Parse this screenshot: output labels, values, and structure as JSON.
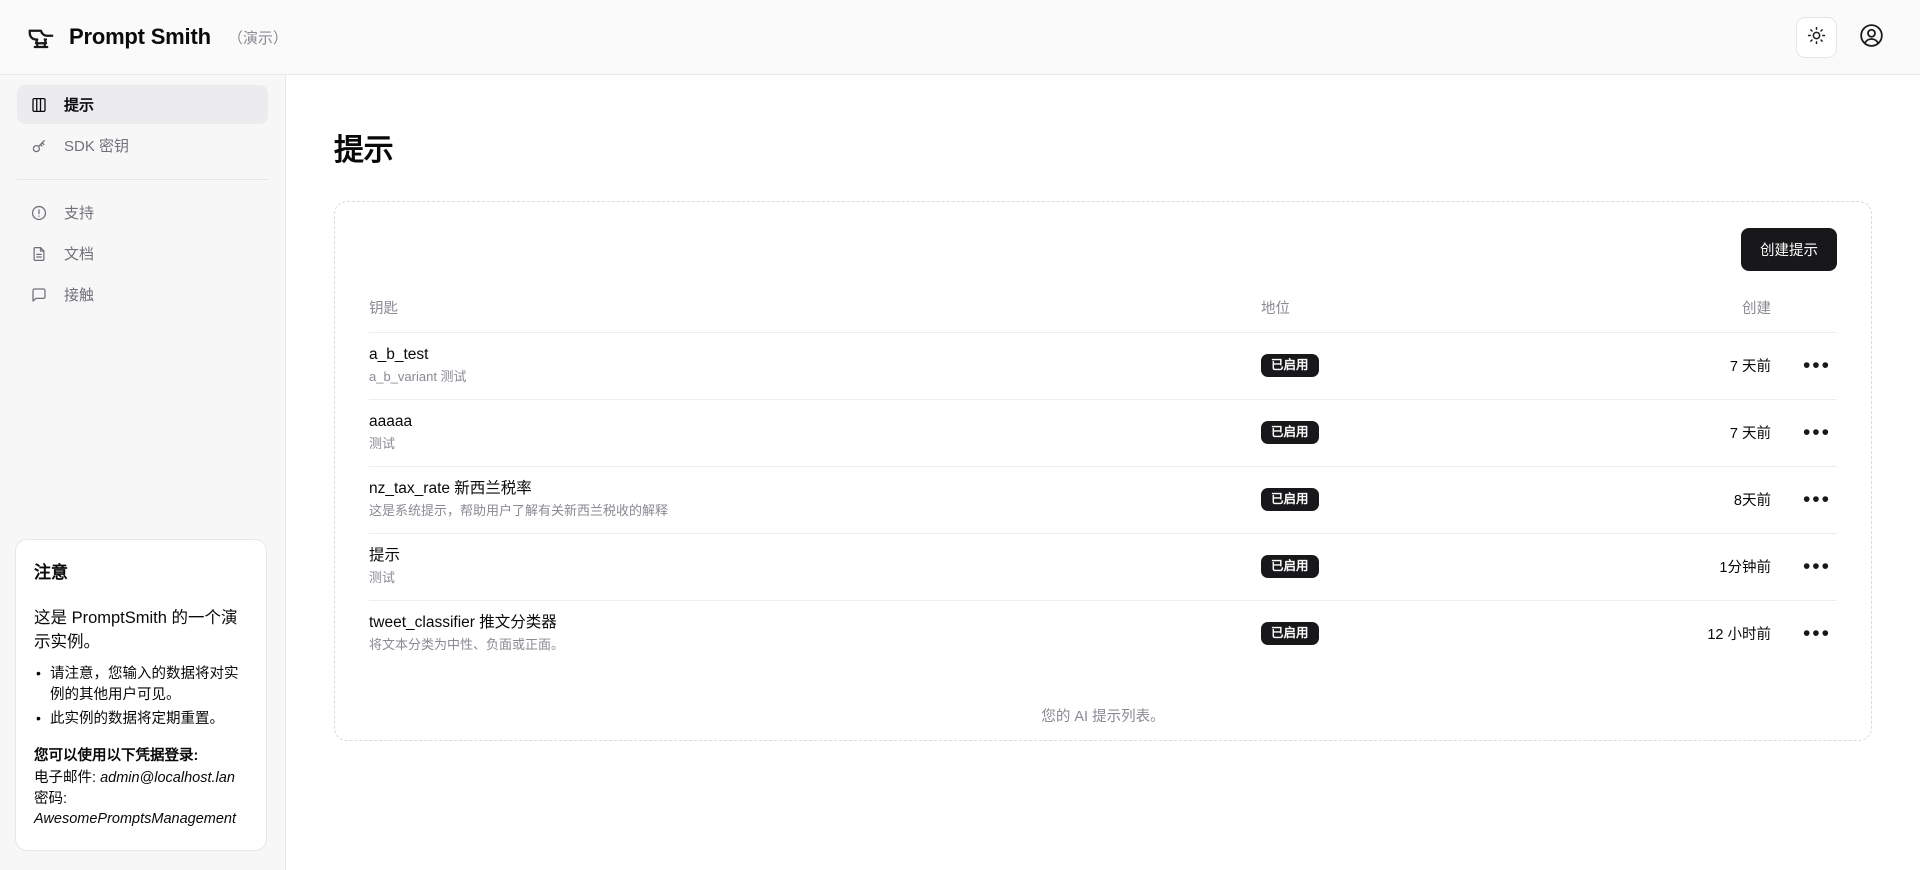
{
  "topbar": {
    "brand_name": "Prompt Smith",
    "brand_suffix": "（演示）",
    "brand_icon": "anvil-icon",
    "theme_icon": "sun-icon",
    "account_icon": "user-circle-icon"
  },
  "sidebar": {
    "primary_items": [
      {
        "label": "提示",
        "icon": "book-icon",
        "active": true
      },
      {
        "label": "SDK 密钥",
        "icon": "key-icon",
        "active": false
      }
    ],
    "secondary_items": [
      {
        "label": "支持",
        "icon": "alert-circle-icon"
      },
      {
        "label": "文档",
        "icon": "file-text-icon"
      },
      {
        "label": "接触",
        "icon": "message-square-icon"
      }
    ],
    "notice": {
      "title": "注意",
      "lead": "这是 PromptSmith 的一个演示实例。",
      "bullets": [
        "请注意，您输入的数据将对实例的其他用户可见。",
        "此实例的数据将定期重置。"
      ],
      "credentials_heading": "您可以使用以下凭据登录:",
      "email_label": "电子邮件:",
      "email_value": "admin@localhost.lan",
      "password_label": "密码:",
      "password_value": "AwesomePromptsManagement"
    }
  },
  "main": {
    "page_title": "提示",
    "create_button": "创建提示",
    "table": {
      "columns": [
        "钥匙",
        "地位",
        "创建"
      ],
      "rows": [
        {
          "key": "a_b_test",
          "desc": "a_b_variant 测试",
          "status": "已启用",
          "created": "7 天前",
          "menu_icon": "ellipsis-icon"
        },
        {
          "key": "aaaaa",
          "desc": "测试",
          "status": "已启用",
          "created": "7 天前",
          "menu_icon": "ellipsis-icon"
        },
        {
          "key": "nz_tax_rate 新西兰税率",
          "desc": "这是系统提示，帮助用户了解有关新西兰税收的解释",
          "status": "已启用",
          "created": "8天前",
          "menu_icon": "ellipsis-icon"
        },
        {
          "key": "提示",
          "desc": "测试",
          "status": "已启用",
          "created": "1分钟前",
          "menu_icon": "ellipsis-icon"
        },
        {
          "key": "tweet_classifier 推文分类器",
          "desc": "将文本分类为中性、负面或正面。",
          "status": "已启用",
          "created": "12 小时前",
          "menu_icon": "ellipsis-icon"
        }
      ],
      "caption": "您的 AI 提示列表。"
    }
  },
  "colors": {
    "accent": "#18181b",
    "sidebar_bg": "#f7f7f8",
    "topbar_bg": "#fafafa",
    "muted_text": "#8a8a93"
  }
}
